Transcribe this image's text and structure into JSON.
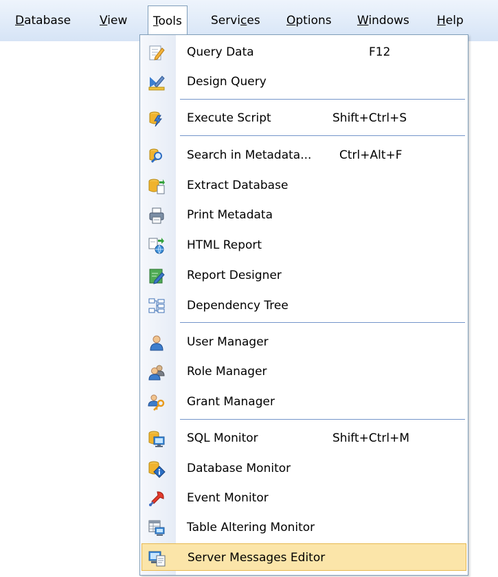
{
  "menubar": {
    "items": [
      {
        "pre": "",
        "acc": "D",
        "post": "atabase"
      },
      {
        "pre": "",
        "acc": "V",
        "post": "iew"
      },
      {
        "pre": "",
        "acc": "T",
        "post": "ools"
      },
      {
        "pre": "Servi",
        "acc": "c",
        "post": "es"
      },
      {
        "pre": "",
        "acc": "O",
        "post": "ptions"
      },
      {
        "pre": "",
        "acc": "W",
        "post": "indows"
      },
      {
        "pre": "",
        "acc": "H",
        "post": "elp"
      }
    ]
  },
  "tools_menu": {
    "items": [
      {
        "label": "Query Data",
        "shortcut": "F12",
        "icon": "query-data-icon"
      },
      {
        "label": "Design Query",
        "shortcut": "",
        "icon": "design-query-icon"
      },
      {
        "label": "Execute Script",
        "shortcut": "Shift+Ctrl+S",
        "icon": "execute-script-icon"
      },
      {
        "label": "Search in Metadata...",
        "shortcut": "Ctrl+Alt+F",
        "icon": "search-metadata-icon"
      },
      {
        "label": "Extract Database",
        "shortcut": "",
        "icon": "extract-database-icon"
      },
      {
        "label": "Print Metadata",
        "shortcut": "",
        "icon": "printer-icon"
      },
      {
        "label": "HTML Report",
        "shortcut": "",
        "icon": "html-report-icon"
      },
      {
        "label": "Report Designer",
        "shortcut": "",
        "icon": "report-designer-icon"
      },
      {
        "label": "Dependency Tree",
        "shortcut": "",
        "icon": "dependency-tree-icon"
      },
      {
        "label": "User Manager",
        "shortcut": "",
        "icon": "user-icon"
      },
      {
        "label": "Role Manager",
        "shortcut": "",
        "icon": "role-icon"
      },
      {
        "label": "Grant Manager",
        "shortcut": "",
        "icon": "grant-key-icon"
      },
      {
        "label": "SQL Monitor",
        "shortcut": "Shift+Ctrl+M",
        "icon": "sql-monitor-icon"
      },
      {
        "label": "Database Monitor",
        "shortcut": "",
        "icon": "database-monitor-icon"
      },
      {
        "label": "Event Monitor",
        "shortcut": "",
        "icon": "event-monitor-icon"
      },
      {
        "label": "Table Altering Monitor",
        "shortcut": "",
        "icon": "table-altering-icon"
      },
      {
        "label": "Server Messages Editor",
        "shortcut": "",
        "icon": "server-messages-icon"
      }
    ],
    "highlighted_item": "Server Messages Editor"
  },
  "colors": {
    "menubar_top": "#eef4fc",
    "menubar_bottom": "#d6e4f6",
    "border": "#7f9db9",
    "separator": "#7394c9",
    "highlight_fill": "#fbe5a9",
    "highlight_border": "#e6b850"
  }
}
